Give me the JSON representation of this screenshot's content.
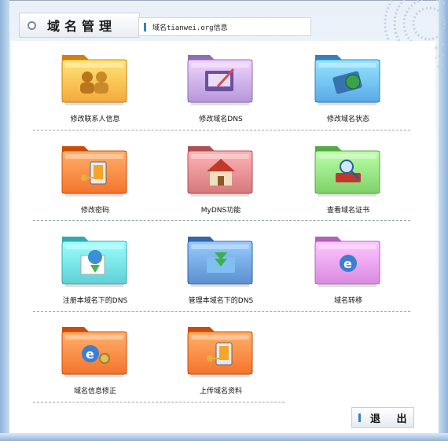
{
  "header": {
    "title": "域名管理",
    "info": "域名tianwei.org信息"
  },
  "items": [
    {
      "label": "修改联系人信息",
      "icon": "contacts-icon",
      "color": "#f5a93b"
    },
    {
      "label": "修改域名DNS",
      "icon": "computer-pen-icon",
      "color": "#b597d9"
    },
    {
      "label": "修改域名状态",
      "icon": "globe-folder-icon",
      "color": "#5aa9e6"
    },
    {
      "label": "修改密码",
      "icon": "key-safe-icon",
      "color": "#f4742e"
    },
    {
      "label": "MyDNS功能",
      "icon": "house-icon",
      "color": "#d6787a"
    },
    {
      "label": "查看域名证书",
      "icon": "magnifier-book-icon",
      "color": "#7fd06a"
    },
    {
      "label": "注册本域名下的DNS",
      "icon": "globe-download-icon",
      "color": "#5fd0d6"
    },
    {
      "label": "管理本域名下的DNS",
      "icon": "folder-arrows-icon",
      "color": "#5b8fd0"
    },
    {
      "label": "域名转移",
      "icon": "ie-globe-icon",
      "color": "#d98ae0"
    },
    {
      "label": "域名信息修正",
      "icon": "ie-gear-icon",
      "color": "#f4742e"
    },
    {
      "label": "上传域名资料",
      "icon": "key-safe-icon",
      "color": "#f4742e"
    }
  ],
  "exit_label": "退 出"
}
